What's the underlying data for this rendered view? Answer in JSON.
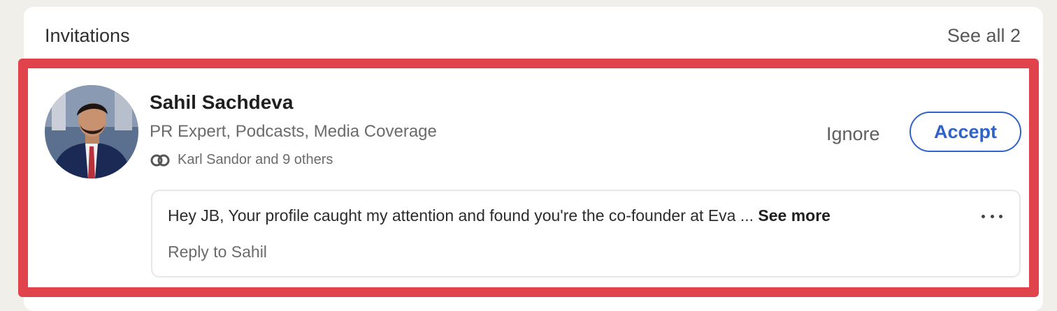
{
  "invitations": {
    "title": "Invitations",
    "see_all_label": "See all 2"
  },
  "invitation": {
    "name": "Sahil Sachdeva",
    "headline": "PR Expert, Podcasts, Media Coverage",
    "mutual_connections": "Karl Sandor and 9 others",
    "ignore_label": "Ignore",
    "accept_label": "Accept",
    "message": {
      "text": "Hey JB, Your profile caught my attention and found you're the co-founder at Eva ...",
      "see_more_label": "See more",
      "reply_label": "Reply to Sahil"
    }
  },
  "icons": {
    "mutual": "mutual-connections-icon",
    "more": "more-options-icon"
  },
  "colors": {
    "highlight": "#e0434c",
    "accent": "#2f63c8"
  }
}
